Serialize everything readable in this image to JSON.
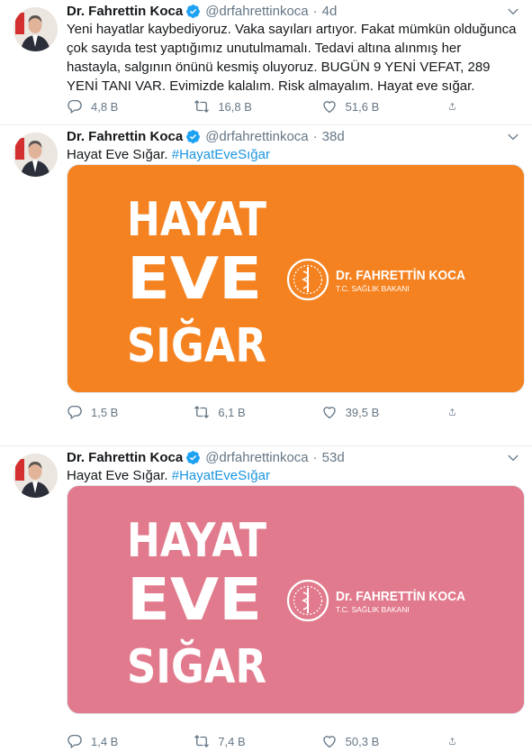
{
  "author": {
    "name": "Dr. Fahrettin Koca",
    "handle": "@drfahrettinkoca"
  },
  "colors": {
    "card1_background": "#f58220",
    "card2_background": "#e17a8d",
    "link": "#1b95e0",
    "verified": "#1da1f2"
  },
  "icons": [
    "verified-badge-icon",
    "chevron-down-icon",
    "reply-icon",
    "retweet-icon",
    "like-icon",
    "share-icon"
  ],
  "tweets": [
    {
      "time": "4d",
      "text": "Yeni hayatlar kaybediyoruz. Vaka sayıları artıyor. Fakat mümkün olduğunca çok sayıda test yaptığımız unutulmamalı. Tedavi altına alınmış her hastayla, salgının önünü kesmiş oluyoruz. BUGÜN 9 YENİ VEFAT, 289 YENİ TANI VAR. Evimizde kalalım. Risk almayalım. Hayat eve sığar.",
      "replies": "4,8 B",
      "retweets": "16,8 B",
      "likes": "51,6 B"
    },
    {
      "time": "38d",
      "text": "Hayat Eve Sığar.",
      "hashtag": "#HayatEveSığar",
      "card": {
        "line1": "HAYAT",
        "line2": "EVE",
        "line3": "SIĞAR",
        "logo_name": "Dr. FAHRETTİN KOCA",
        "logo_title": "T.C. SAĞLIK BAKANI"
      },
      "replies": "1,5 B",
      "retweets": "6,1 B",
      "likes": "39,5 B"
    },
    {
      "time": "53d",
      "text": "Hayat Eve Sığar.",
      "hashtag": "#HayatEveSığar",
      "card": {
        "line1": "HAYAT",
        "line2": "EVE",
        "line3": "SIĞAR",
        "logo_name": "Dr. FAHRETTİN KOCA",
        "logo_title": "T.C. SAĞLIK BAKANI"
      },
      "replies": "1,4 B",
      "retweets": "7,4 B",
      "likes": "50,3 B"
    }
  ]
}
